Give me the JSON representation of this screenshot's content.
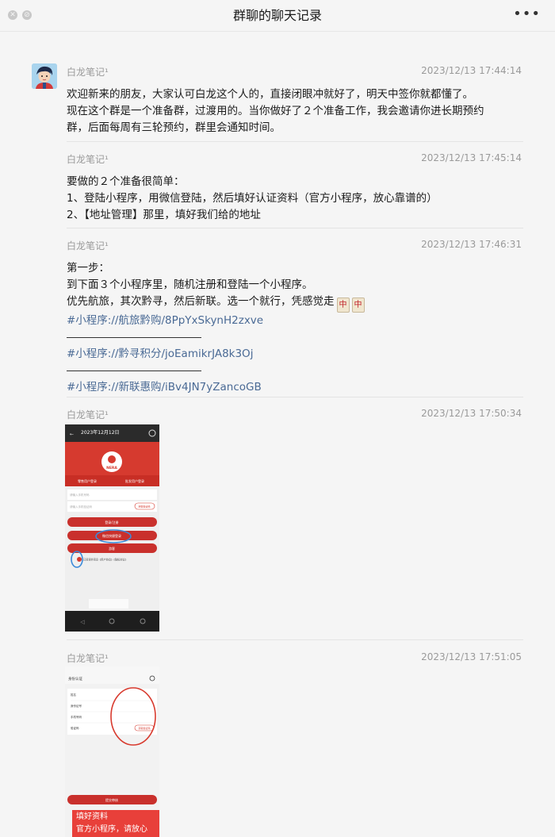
{
  "window": {
    "title": "群聊的聊天记录"
  },
  "messages": [
    {
      "sender": "白龙笔记¹",
      "time": "2023/12/13 17:44:14",
      "lines": [
        "欢迎新来的朋友，大家认可白龙这个人的，直接闭眼冲就好了，明天中签你就都懂了。",
        "现在这个群是一个准备群，过渡用的。当你做好了２个准备工作，我会邀请你进长期预约",
        "群，后面每周有三轮预约，群里会通知时间。"
      ]
    },
    {
      "sender": "白龙笔记¹",
      "time": "2023/12/13 17:45:14",
      "lines": [
        "要做的２个准备很简单：",
        "1、登陆小程序，用微信登陆，然后填好认证资料（官方小程序，放心靠谱的）",
        "2、【地址管理】那里，填好我们给的地址"
      ]
    },
    {
      "sender": "白龙笔记¹",
      "time": "2023/12/13 17:46:31",
      "lines": [
        "第一步：",
        "到下面３个小程序里，随机注册和登陆一个小程序。",
        "优先航旅，其次黔寻，然后新联。选一个就行，凭感觉走"
      ],
      "emoji": "中",
      "links": [
        "#小程序://航旅黔购/8PpYxSkynH2zxve",
        "#小程序://黔寻积分/joEamikrJA8k3Oj",
        "#小程序://新联惠购/iBv4JN7yZancoGB"
      ]
    },
    {
      "sender": "白龙笔记¹",
      "time": "2023/12/13 17:50:34",
      "image": {
        "date": "2023年12月12日",
        "logo": "NERA",
        "tab_left": "零售用户登录",
        "tab_right": "批发用户登录",
        "field1": "请输入手机号码",
        "field2": "请输入手机验证码",
        "code_btn": "获取验证码",
        "btn1": "登录/注册",
        "btn2": "微信快捷登录",
        "btn3": "游客",
        "agree": "已阅读并同意《用户协议》《隐私协议》"
      }
    },
    {
      "sender": "白龙笔记¹",
      "time": "2023/12/13 17:51:05",
      "image": {
        "page_title": "身份认证",
        "row1": "姓名",
        "row2": "身份证号",
        "row3": "手机号码",
        "row4": "验证码",
        "code_btn": "获取验证码",
        "submit": "提交审核",
        "overlay_line1": "填好资料",
        "overlay_line2": "官方小程序，请放心"
      }
    }
  ]
}
